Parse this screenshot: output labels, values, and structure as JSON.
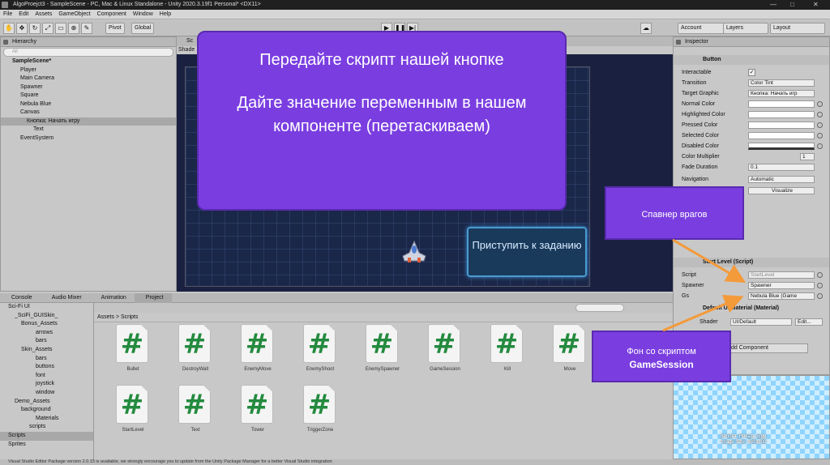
{
  "window": {
    "title": "AlgoProejct3 - SampleScene - PC, Mac & Linux Standalone - Unity 2020.3.19f1 Personal* <DX11>"
  },
  "menu": [
    "File",
    "Edit",
    "Assets",
    "GameObject",
    "Component",
    "Window",
    "Help"
  ],
  "toolbar": {
    "pivot": "Pivot",
    "global": "Global",
    "account": "Account",
    "layers": "Layers",
    "layout": "Layout"
  },
  "hierarchy": {
    "title": "Hierarchy",
    "search": "All",
    "items": [
      "SampleScene*",
      "Player",
      "Main Camera",
      "Spawner",
      "Square",
      "Nebula Blue",
      "Canvas",
      "Кнопка: Начать игру",
      "Text",
      "EventSystem"
    ]
  },
  "scene": {
    "tab": "Sc",
    "shaded": "Shade",
    "start_button": "Приступить к заданию"
  },
  "inspector": {
    "title": "Inspector",
    "component": "Button",
    "fields": [
      {
        "label": "Interactable",
        "value": "✓"
      },
      {
        "label": "Transition",
        "value": "Color Tint"
      },
      {
        "label": "Target Graphic",
        "value": "Кнопка: Начать игр"
      },
      {
        "label": "Normal Color",
        "value": ""
      },
      {
        "label": "Highlighted Color",
        "value": ""
      },
      {
        "label": "Pressed Color",
        "value": ""
      },
      {
        "label": "Selected Color",
        "value": ""
      },
      {
        "label": "Disabled Color",
        "value": ""
      },
      {
        "label": "Color Multiplier",
        "value": "1"
      },
      {
        "label": "Fade Duration",
        "value": "0.1"
      }
    ],
    "navigation_label": "Navigation",
    "navigation_value": "Automatic",
    "visualize": "Visualize",
    "script_component": "Start Level (Script)",
    "script_fields": [
      {
        "label": "Script",
        "value": "StartLevel"
      },
      {
        "label": "Spawner",
        "value": "Spawner"
      },
      {
        "label": "Gs",
        "value": "Nebula Blue (Game"
      }
    ],
    "material": "Default UI Material (Material)",
    "shader_label": "Shader",
    "shader_value": "UI/Default",
    "edit": "Edit...",
    "add_component": "dd Component"
  },
  "bottom_tabs": [
    "Console",
    "Audio Mixer",
    "Animation",
    "Project"
  ],
  "project_tree": [
    "Sci-Fi UI",
    "_SciFi_GUISkin_",
    "Bonus_Assets",
    "arrows",
    "bars",
    "Skin_Assets",
    "bars",
    "buttons",
    "font",
    "joystick",
    "window",
    "Demo_Assets",
    "background",
    "Materials",
    "scripts",
    "Scripts",
    "Sprites"
  ],
  "breadcrumb": "Assets > Scripts",
  "assets": [
    "Bullet",
    "DestroyWall",
    "EnemyMove",
    "EnemyShoot",
    "EnemySpawner",
    "GameSession",
    "Kill",
    "Move",
    "StartLevel",
    "Text",
    "Tower",
    "TriggerZone"
  ],
  "asset_glyph": "#",
  "status": "Visual Studio Editor Package version 2.0.15 is available, we strongly encourage you to update from the Unity Package Manager for a better Visual Studio integration",
  "preview_caption": "Кнопка: Начать игру\nImage Size: 488x108",
  "callouts": {
    "main_line1": "Передайте скрипт нашей кнопке",
    "main_line2": "Дайте значение переменным в нашем компоненте (перетаскиваем)",
    "spawner": "Спавнер врагов",
    "background_line1": "Фон со скриптом",
    "background_line2": "GameSession"
  },
  "colors": {
    "callout": "#7a3ee0",
    "arrow": "#f39a3a",
    "script_green": "#238a3e"
  }
}
